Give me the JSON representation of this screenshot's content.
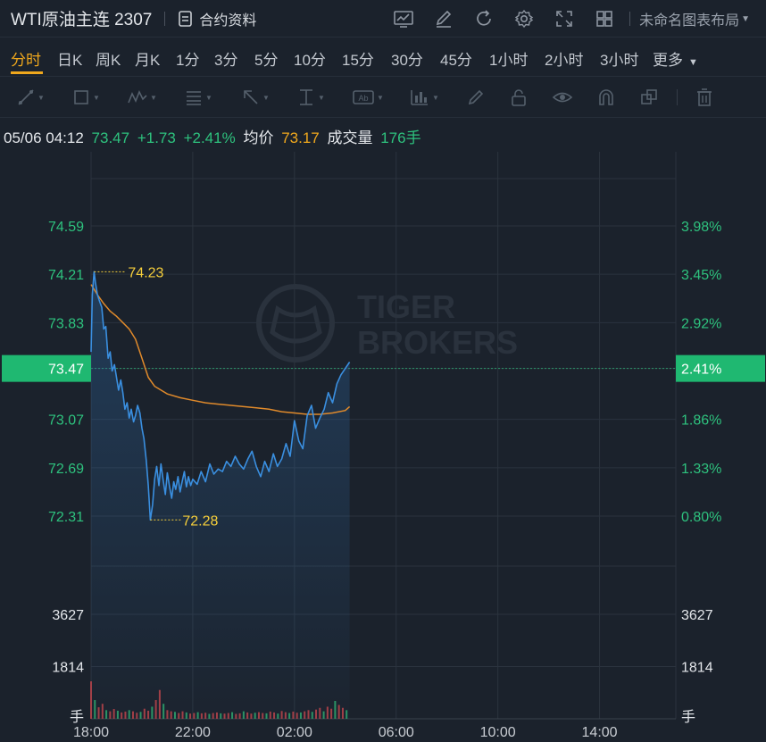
{
  "header": {
    "title": "WTI原油主连 2307",
    "doc_label": "合约资料",
    "layout_name": "未命名图表布局",
    "icons": [
      "indicator-icon",
      "draw-icon",
      "refresh-icon",
      "settings-icon",
      "fullscreen-icon",
      "grid-layout-icon"
    ]
  },
  "tabs": [
    {
      "label": "分时",
      "active": true
    },
    {
      "label": "日K"
    },
    {
      "label": "周K"
    },
    {
      "label": "月K"
    },
    {
      "label": "1分"
    },
    {
      "label": "3分"
    },
    {
      "label": "5分"
    },
    {
      "label": "10分"
    },
    {
      "label": "15分"
    },
    {
      "label": "30分"
    },
    {
      "label": "45分"
    },
    {
      "label": "1小时"
    },
    {
      "label": "2小时"
    },
    {
      "label": "3小时"
    },
    {
      "label": "更多"
    }
  ],
  "drawing_tools": [
    "line-tool-icon",
    "rectangle-tool-icon",
    "pattern-tool-icon",
    "fibonacci-tool-icon",
    "arrow-tool-icon",
    "measure-tool-icon",
    "text-tool-icon",
    "price-note-tool-icon",
    "pencil-icon",
    "lock-icon",
    "eye-icon",
    "magnet-icon",
    "copy-icon",
    "trash-icon"
  ],
  "info": {
    "datetime": "05/06 04:12",
    "price": "73.47",
    "change": "+1.73",
    "change_pct": "+2.41%",
    "avg_label": "均价",
    "avg_value": "73.17",
    "volume_label": "成交量",
    "volume_value": "176手"
  },
  "watermark": {
    "line1": "TIGER",
    "line2": "BROKERS"
  },
  "colors": {
    "background": "#1b222c",
    "price_line": "#3a8fe0",
    "avg_line": "#e08a2b",
    "up": "#2ec27e",
    "accent": "#f0a81d",
    "label_text": "#f6cf3b"
  },
  "chart_data": {
    "type": "line",
    "x_ticks": [
      "18:00",
      "22:00",
      "02:00",
      "06:00",
      "10:00",
      "14:00"
    ],
    "price_ticks": [
      "74.59",
      "74.21",
      "73.83",
      "73.47",
      "73.07",
      "72.69",
      "72.31"
    ],
    "pct_ticks": [
      "3.98%",
      "3.45%",
      "2.92%",
      "2.41%",
      "1.86%",
      "1.33%",
      "0.80%"
    ],
    "current_price_label": "73.47",
    "current_pct_label": "2.41%",
    "high_label": "74.23",
    "low_label": "72.28",
    "volume_ticks": [
      "3627",
      "1814"
    ],
    "volume_unit": "手",
    "series": [
      {
        "name": "价格",
        "x": [
          18.0,
          18.05,
          18.12,
          18.17,
          18.25,
          18.33,
          18.42,
          18.5,
          18.58,
          18.67,
          18.75,
          18.83,
          18.92,
          19.0,
          19.08,
          19.17,
          19.25,
          19.33,
          19.42,
          19.5,
          19.58,
          19.67,
          19.75,
          19.83,
          19.92,
          20.0,
          20.08,
          20.17,
          20.25,
          20.33,
          20.42,
          20.5,
          20.58,
          20.67,
          20.75,
          20.83,
          20.92,
          21.0,
          21.08,
          21.17,
          21.25,
          21.33,
          21.42,
          21.5,
          21.58,
          21.67,
          21.75,
          21.83,
          21.92,
          22.0,
          22.17,
          22.33,
          22.5,
          22.67,
          22.83,
          23.0,
          23.17,
          23.33,
          23.5,
          23.67,
          23.83,
          24.0,
          24.17,
          24.33,
          24.5,
          24.67,
          24.83,
          25.0,
          25.17,
          25.33,
          25.5,
          25.67,
          25.83,
          26.0,
          26.17,
          26.33,
          26.5,
          26.67,
          26.83,
          27.0,
          27.17,
          27.33,
          27.5,
          27.67,
          27.83,
          28.0,
          28.17
        ],
        "values": [
          73.6,
          74.05,
          74.23,
          74.15,
          74.05,
          74.0,
          73.95,
          73.78,
          73.8,
          73.55,
          73.6,
          73.45,
          73.5,
          73.4,
          73.3,
          73.38,
          73.28,
          73.15,
          73.2,
          73.08,
          73.15,
          73.05,
          73.1,
          73.18,
          73.12,
          73.0,
          72.92,
          72.75,
          72.55,
          72.28,
          72.4,
          72.6,
          72.7,
          72.55,
          72.72,
          72.6,
          72.48,
          72.65,
          72.55,
          72.45,
          72.58,
          72.52,
          72.62,
          72.5,
          72.58,
          72.66,
          72.54,
          72.62,
          72.55,
          72.6,
          72.56,
          72.66,
          72.58,
          72.72,
          72.64,
          72.68,
          72.66,
          72.74,
          72.7,
          72.78,
          72.72,
          72.68,
          72.76,
          72.82,
          72.7,
          72.62,
          72.74,
          72.66,
          72.8,
          72.7,
          72.76,
          72.88,
          72.78,
          73.06,
          72.9,
          72.84,
          73.1,
          73.18,
          73.0,
          73.08,
          73.15,
          73.28,
          73.2,
          73.35,
          73.42,
          73.47,
          73.52
        ]
      },
      {
        "name": "均价",
        "x": [
          18.0,
          18.25,
          18.5,
          18.75,
          19.0,
          19.25,
          19.5,
          19.75,
          20.0,
          20.25,
          20.5,
          21.0,
          21.5,
          22.0,
          22.5,
          23.0,
          23.5,
          24.0,
          24.5,
          25.0,
          25.5,
          26.0,
          26.5,
          27.0,
          27.5,
          28.0,
          28.17
        ],
        "values": [
          74.13,
          74.05,
          73.98,
          73.92,
          73.88,
          73.83,
          73.78,
          73.7,
          73.55,
          73.4,
          73.33,
          73.27,
          73.24,
          73.22,
          73.2,
          73.19,
          73.18,
          73.17,
          73.16,
          73.15,
          73.13,
          73.12,
          73.11,
          73.11,
          73.12,
          73.14,
          73.17
        ]
      },
      {
        "name": "成交量",
        "x": [
          18.0,
          18.15,
          18.3,
          18.45,
          18.6,
          18.75,
          18.9,
          19.05,
          19.2,
          19.35,
          19.5,
          19.65,
          19.8,
          19.95,
          20.1,
          20.25,
          20.4,
          20.55,
          20.7,
          20.85,
          21.0,
          21.15,
          21.3,
          21.45,
          21.6,
          21.75,
          21.9,
          22.05,
          22.2,
          22.35,
          22.5,
          22.65,
          22.8,
          22.95,
          23.1,
          23.25,
          23.4,
          23.55,
          23.7,
          23.85,
          24.0,
          24.15,
          24.3,
          24.45,
          24.6,
          24.75,
          24.9,
          25.05,
          25.2,
          25.35,
          25.5,
          25.65,
          25.8,
          25.95,
          26.1,
          26.25,
          26.4,
          26.55,
          26.7,
          26.85,
          27.0,
          27.15,
          27.3,
          27.45,
          27.6,
          27.75,
          27.9,
          28.05
        ],
        "values": [
          1300,
          650,
          400,
          520,
          300,
          260,
          340,
          280,
          220,
          250,
          300,
          260,
          210,
          240,
          350,
          280,
          420,
          650,
          1000,
          520,
          300,
          260,
          240,
          200,
          260,
          220,
          180,
          200,
          230,
          190,
          210,
          170,
          200,
          220,
          190,
          180,
          200,
          230,
          170,
          190,
          260,
          220,
          180,
          210,
          230,
          200,
          190,
          250,
          220,
          180,
          270,
          230,
          200,
          250,
          210,
          220,
          260,
          300,
          240,
          320,
          380,
          260,
          420,
          350,
          620,
          480,
          380,
          300
        ]
      }
    ],
    "ylim": [
      72.0,
      74.9
    ],
    "volume_max": 3627,
    "grid": true
  }
}
